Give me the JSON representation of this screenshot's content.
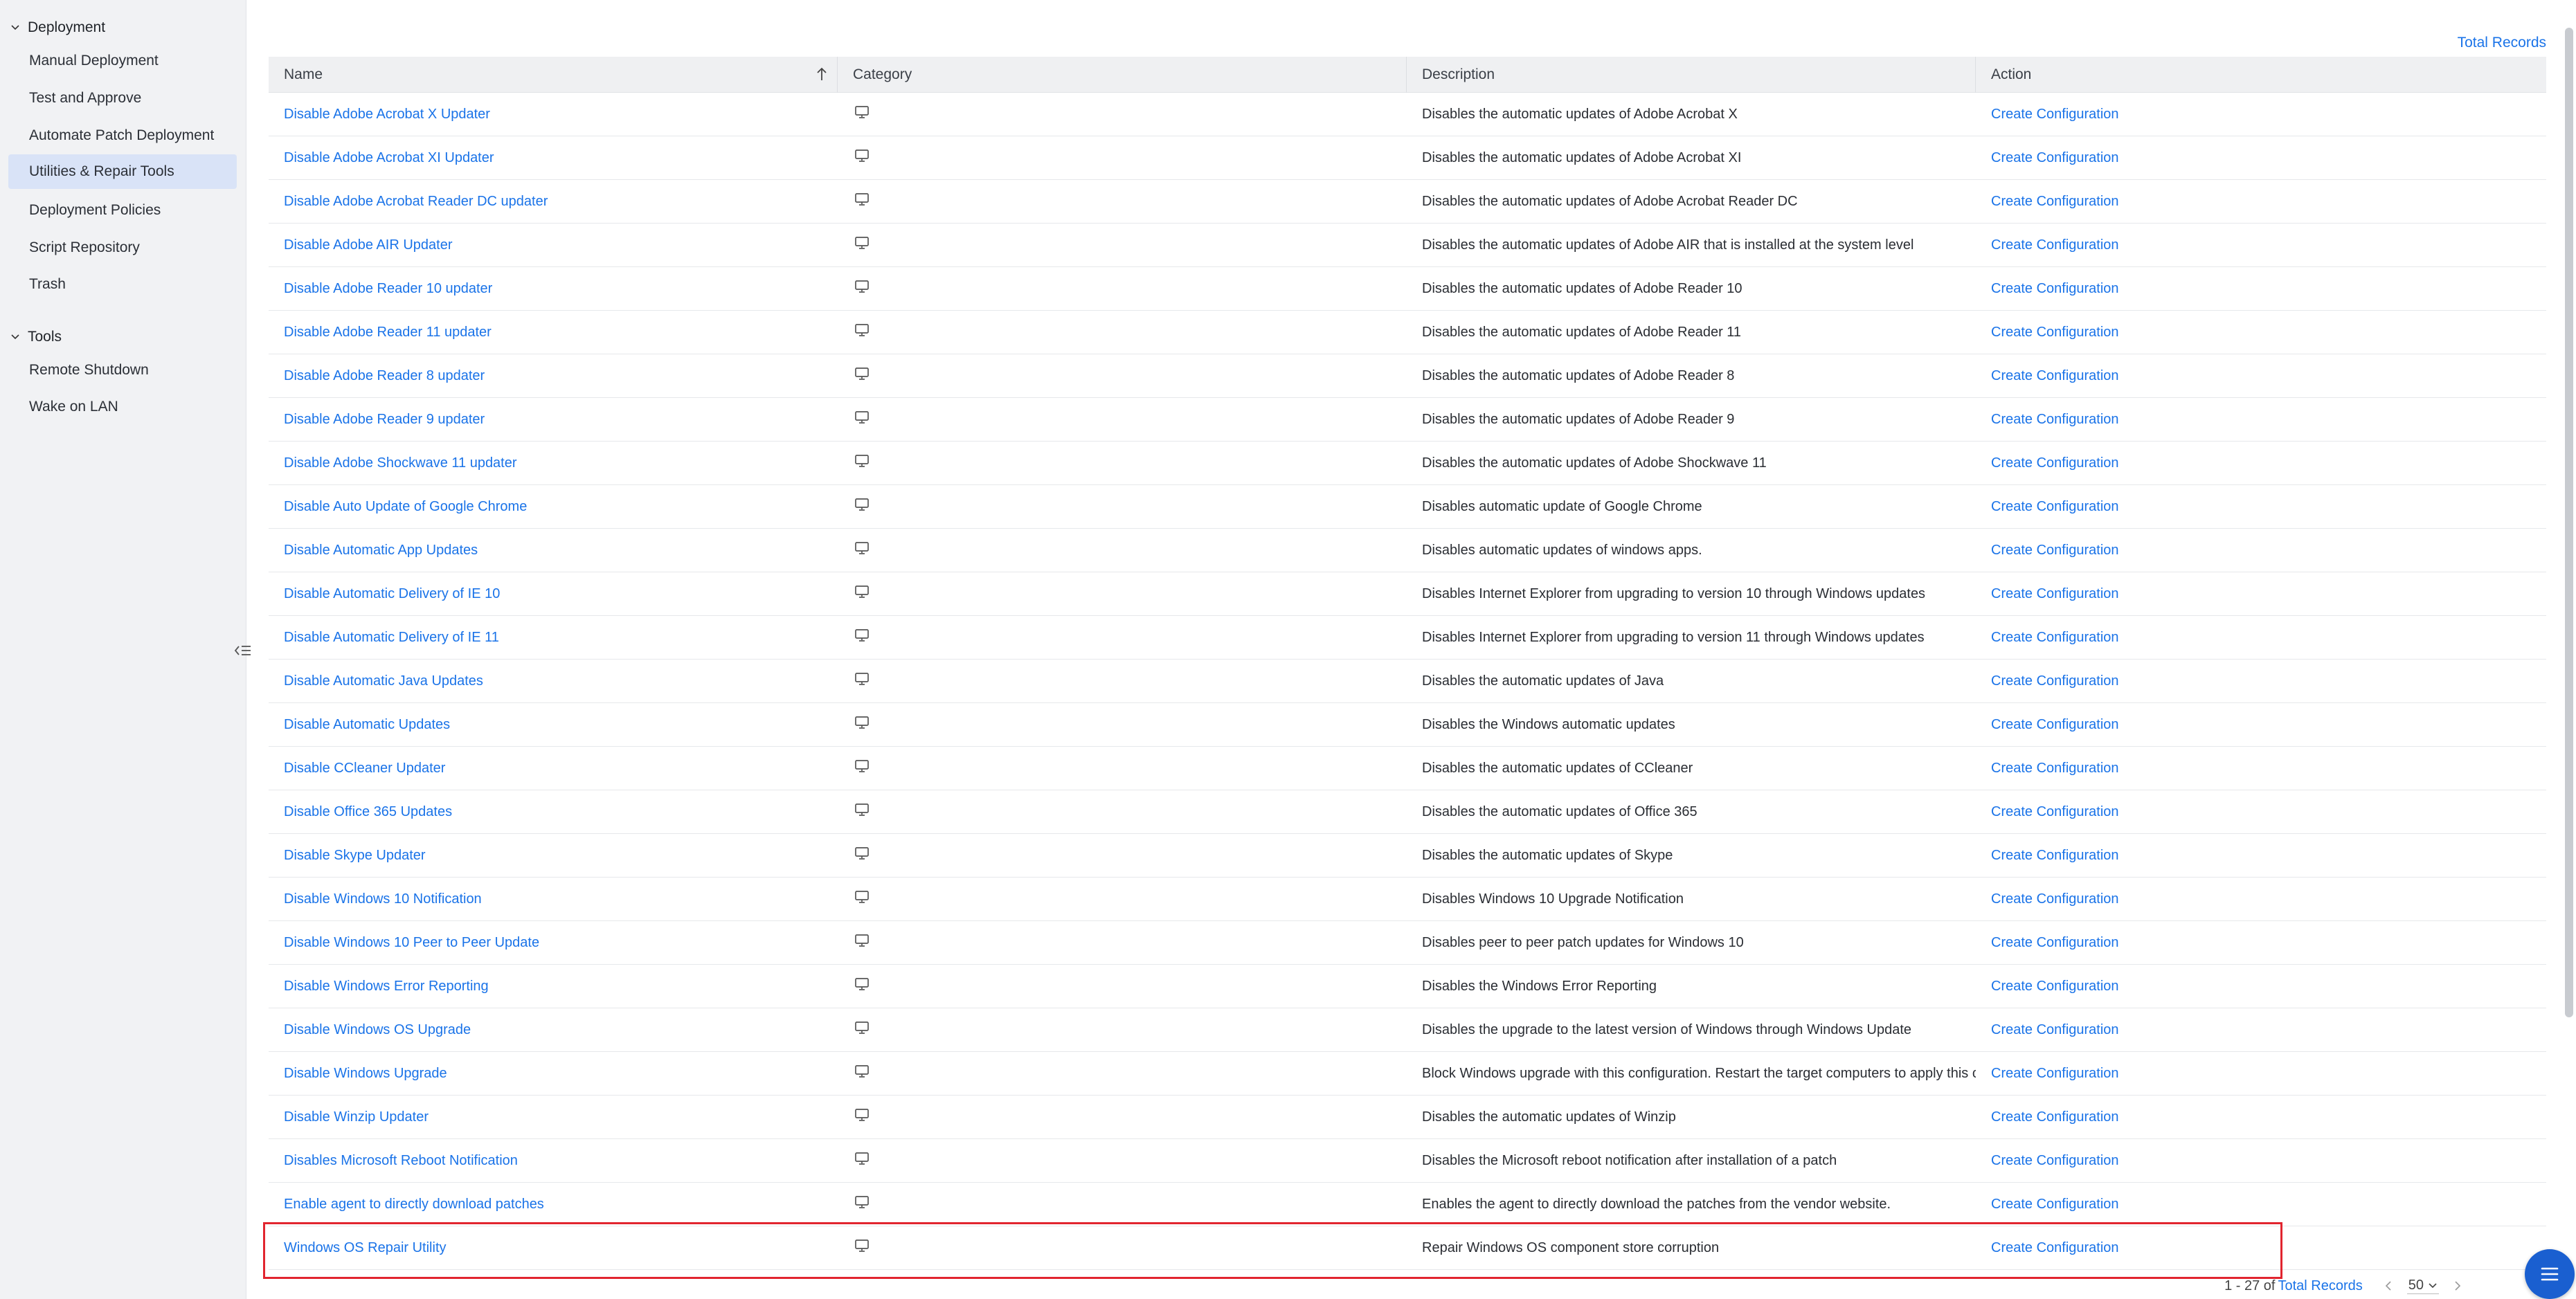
{
  "sidebar": {
    "deployment_header": "Deployment",
    "deployment_items": [
      {
        "label": "Manual Deployment",
        "active": false
      },
      {
        "label": "Test and Approve",
        "active": false
      },
      {
        "label": "Automate Patch Deployment",
        "active": false
      },
      {
        "label": "Utilities & Repair Tools",
        "active": true
      },
      {
        "label": "Deployment Policies",
        "active": false
      },
      {
        "label": "Script Repository",
        "active": false
      },
      {
        "label": "Trash",
        "active": false
      }
    ],
    "tools_header": "Tools",
    "tools_items": [
      {
        "label": "Remote Shutdown"
      },
      {
        "label": "Wake on LAN"
      }
    ]
  },
  "top_link": "Total Records",
  "table": {
    "columns": [
      "Name",
      "Category",
      "Description",
      "Action"
    ],
    "rows": [
      {
        "name": "Disable Adobe Acrobat X Updater",
        "description": "Disables the automatic updates of Adobe Acrobat X",
        "action": "Create Configuration"
      },
      {
        "name": "Disable Adobe Acrobat XI Updater",
        "description": "Disables the automatic updates of Adobe Acrobat XI",
        "action": "Create Configuration"
      },
      {
        "name": "Disable Adobe Acrobat Reader DC updater",
        "description": "Disables the automatic updates of Adobe Acrobat Reader DC",
        "action": "Create Configuration"
      },
      {
        "name": "Disable Adobe AIR Updater",
        "description": "Disables the automatic updates of Adobe AIR that is installed at the system level",
        "action": "Create Configuration"
      },
      {
        "name": "Disable Adobe Reader 10 updater",
        "description": "Disables the automatic updates of Adobe Reader 10",
        "action": "Create Configuration"
      },
      {
        "name": "Disable Adobe Reader 11 updater",
        "description": "Disables the automatic updates of Adobe Reader 11",
        "action": "Create Configuration"
      },
      {
        "name": "Disable Adobe Reader 8 updater",
        "description": "Disables the automatic updates of Adobe Reader 8",
        "action": "Create Configuration"
      },
      {
        "name": "Disable Adobe Reader 9 updater",
        "description": "Disables the automatic updates of Adobe Reader 9",
        "action": "Create Configuration"
      },
      {
        "name": "Disable Adobe Shockwave 11 updater",
        "description": "Disables the automatic updates of Adobe Shockwave 11",
        "action": "Create Configuration"
      },
      {
        "name": "Disable Auto Update of Google Chrome",
        "description": "Disables automatic update of Google Chrome",
        "action": "Create Configuration"
      },
      {
        "name": "Disable Automatic App Updates",
        "description": "Disables automatic updates of windows apps.",
        "action": "Create Configuration"
      },
      {
        "name": "Disable Automatic Delivery of IE 10",
        "description": "Disables Internet Explorer from upgrading to version 10 through Windows updates",
        "action": "Create Configuration"
      },
      {
        "name": "Disable Automatic Delivery of IE 11",
        "description": "Disables Internet Explorer from upgrading to version 11 through Windows updates",
        "action": "Create Configuration"
      },
      {
        "name": "Disable Automatic Java Updates",
        "description": "Disables the automatic updates of Java",
        "action": "Create Configuration"
      },
      {
        "name": "Disable Automatic Updates",
        "description": "Disables the Windows automatic updates",
        "action": "Create Configuration"
      },
      {
        "name": "Disable CCleaner Updater",
        "description": "Disables the automatic updates of CCleaner",
        "action": "Create Configuration"
      },
      {
        "name": "Disable Office 365 Updates",
        "description": "Disables the automatic updates of Office 365",
        "action": "Create Configuration"
      },
      {
        "name": "Disable Skype Updater",
        "description": "Disables the automatic updates of Skype",
        "action": "Create Configuration"
      },
      {
        "name": "Disable Windows 10 Notification",
        "description": "Disables Windows 10 Upgrade Notification",
        "action": "Create Configuration"
      },
      {
        "name": "Disable Windows 10 Peer to Peer Update",
        "description": "Disables peer to peer patch updates for Windows 10",
        "action": "Create Configuration"
      },
      {
        "name": "Disable Windows Error Reporting",
        "description": "Disables the Windows Error Reporting",
        "action": "Create Configuration"
      },
      {
        "name": "Disable Windows OS Upgrade",
        "description": "Disables the upgrade to the latest version of Windows through Windows Update",
        "action": "Create Configuration"
      },
      {
        "name": "Disable Windows Upgrade",
        "description": "Block Windows upgrade with this configuration. Restart the target computers to apply this c...",
        "action": "Create Configuration"
      },
      {
        "name": "Disable Winzip Updater",
        "description": "Disables the automatic updates of Winzip",
        "action": "Create Configuration"
      },
      {
        "name": "Disables Microsoft Reboot Notification",
        "description": "Disables the Microsoft reboot notification after installation of a patch",
        "action": "Create Configuration"
      },
      {
        "name": "Enable agent to directly download patches",
        "description": "Enables the agent to directly download the patches from the vendor website.",
        "action": "Create Configuration"
      },
      {
        "name": "Windows OS Repair Utility",
        "description": "Repair Windows OS component store corruption",
        "action": "Create Configuration"
      }
    ]
  },
  "pager": {
    "range": "1 - 27 of",
    "total_link": "Total Records",
    "page_size": "50"
  },
  "icons": {
    "category": "monitor-icon",
    "sort": "sort-ascending-icon",
    "collapse": "collapse-sidebar-icon",
    "fab": "menu-icon"
  },
  "colors": {
    "link": "#1a73e8",
    "active_nav_bg": "#d9e3f7",
    "highlight": "#e1252f",
    "fab": "#1a5fd0"
  }
}
